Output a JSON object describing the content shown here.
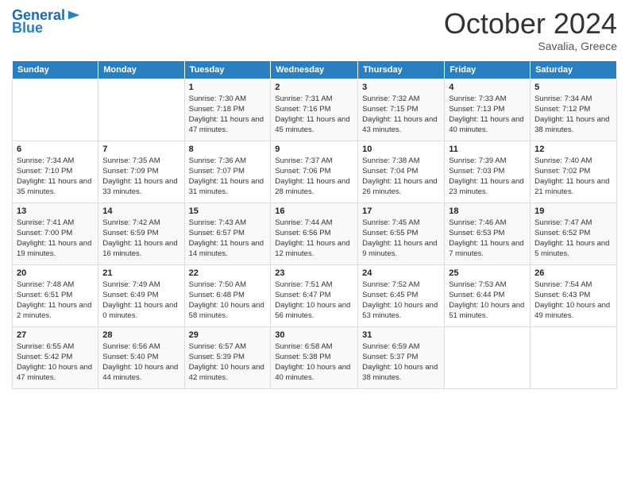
{
  "header": {
    "logo_line1": "General",
    "logo_line2": "Blue",
    "month": "October 2024",
    "location": "Savalia, Greece"
  },
  "days_of_week": [
    "Sunday",
    "Monday",
    "Tuesday",
    "Wednesday",
    "Thursday",
    "Friday",
    "Saturday"
  ],
  "weeks": [
    [
      {
        "day": "",
        "sunrise": "",
        "sunset": "",
        "daylight": ""
      },
      {
        "day": "",
        "sunrise": "",
        "sunset": "",
        "daylight": ""
      },
      {
        "day": "1",
        "sunrise": "Sunrise: 7:30 AM",
        "sunset": "Sunset: 7:18 PM",
        "daylight": "Daylight: 11 hours and 47 minutes."
      },
      {
        "day": "2",
        "sunrise": "Sunrise: 7:31 AM",
        "sunset": "Sunset: 7:16 PM",
        "daylight": "Daylight: 11 hours and 45 minutes."
      },
      {
        "day": "3",
        "sunrise": "Sunrise: 7:32 AM",
        "sunset": "Sunset: 7:15 PM",
        "daylight": "Daylight: 11 hours and 43 minutes."
      },
      {
        "day": "4",
        "sunrise": "Sunrise: 7:33 AM",
        "sunset": "Sunset: 7:13 PM",
        "daylight": "Daylight: 11 hours and 40 minutes."
      },
      {
        "day": "5",
        "sunrise": "Sunrise: 7:34 AM",
        "sunset": "Sunset: 7:12 PM",
        "daylight": "Daylight: 11 hours and 38 minutes."
      }
    ],
    [
      {
        "day": "6",
        "sunrise": "Sunrise: 7:34 AM",
        "sunset": "Sunset: 7:10 PM",
        "daylight": "Daylight: 11 hours and 35 minutes."
      },
      {
        "day": "7",
        "sunrise": "Sunrise: 7:35 AM",
        "sunset": "Sunset: 7:09 PM",
        "daylight": "Daylight: 11 hours and 33 minutes."
      },
      {
        "day": "8",
        "sunrise": "Sunrise: 7:36 AM",
        "sunset": "Sunset: 7:07 PM",
        "daylight": "Daylight: 11 hours and 31 minutes."
      },
      {
        "day": "9",
        "sunrise": "Sunrise: 7:37 AM",
        "sunset": "Sunset: 7:06 PM",
        "daylight": "Daylight: 11 hours and 28 minutes."
      },
      {
        "day": "10",
        "sunrise": "Sunrise: 7:38 AM",
        "sunset": "Sunset: 7:04 PM",
        "daylight": "Daylight: 11 hours and 26 minutes."
      },
      {
        "day": "11",
        "sunrise": "Sunrise: 7:39 AM",
        "sunset": "Sunset: 7:03 PM",
        "daylight": "Daylight: 11 hours and 23 minutes."
      },
      {
        "day": "12",
        "sunrise": "Sunrise: 7:40 AM",
        "sunset": "Sunset: 7:02 PM",
        "daylight": "Daylight: 11 hours and 21 minutes."
      }
    ],
    [
      {
        "day": "13",
        "sunrise": "Sunrise: 7:41 AM",
        "sunset": "Sunset: 7:00 PM",
        "daylight": "Daylight: 11 hours and 19 minutes."
      },
      {
        "day": "14",
        "sunrise": "Sunrise: 7:42 AM",
        "sunset": "Sunset: 6:59 PM",
        "daylight": "Daylight: 11 hours and 16 minutes."
      },
      {
        "day": "15",
        "sunrise": "Sunrise: 7:43 AM",
        "sunset": "Sunset: 6:57 PM",
        "daylight": "Daylight: 11 hours and 14 minutes."
      },
      {
        "day": "16",
        "sunrise": "Sunrise: 7:44 AM",
        "sunset": "Sunset: 6:56 PM",
        "daylight": "Daylight: 11 hours and 12 minutes."
      },
      {
        "day": "17",
        "sunrise": "Sunrise: 7:45 AM",
        "sunset": "Sunset: 6:55 PM",
        "daylight": "Daylight: 11 hours and 9 minutes."
      },
      {
        "day": "18",
        "sunrise": "Sunrise: 7:46 AM",
        "sunset": "Sunset: 6:53 PM",
        "daylight": "Daylight: 11 hours and 7 minutes."
      },
      {
        "day": "19",
        "sunrise": "Sunrise: 7:47 AM",
        "sunset": "Sunset: 6:52 PM",
        "daylight": "Daylight: 11 hours and 5 minutes."
      }
    ],
    [
      {
        "day": "20",
        "sunrise": "Sunrise: 7:48 AM",
        "sunset": "Sunset: 6:51 PM",
        "daylight": "Daylight: 11 hours and 2 minutes."
      },
      {
        "day": "21",
        "sunrise": "Sunrise: 7:49 AM",
        "sunset": "Sunset: 6:49 PM",
        "daylight": "Daylight: 11 hours and 0 minutes."
      },
      {
        "day": "22",
        "sunrise": "Sunrise: 7:50 AM",
        "sunset": "Sunset: 6:48 PM",
        "daylight": "Daylight: 10 hours and 58 minutes."
      },
      {
        "day": "23",
        "sunrise": "Sunrise: 7:51 AM",
        "sunset": "Sunset: 6:47 PM",
        "daylight": "Daylight: 10 hours and 56 minutes."
      },
      {
        "day": "24",
        "sunrise": "Sunrise: 7:52 AM",
        "sunset": "Sunset: 6:45 PM",
        "daylight": "Daylight: 10 hours and 53 minutes."
      },
      {
        "day": "25",
        "sunrise": "Sunrise: 7:53 AM",
        "sunset": "Sunset: 6:44 PM",
        "daylight": "Daylight: 10 hours and 51 minutes."
      },
      {
        "day": "26",
        "sunrise": "Sunrise: 7:54 AM",
        "sunset": "Sunset: 6:43 PM",
        "daylight": "Daylight: 10 hours and 49 minutes."
      }
    ],
    [
      {
        "day": "27",
        "sunrise": "Sunrise: 6:55 AM",
        "sunset": "Sunset: 5:42 PM",
        "daylight": "Daylight: 10 hours and 47 minutes."
      },
      {
        "day": "28",
        "sunrise": "Sunrise: 6:56 AM",
        "sunset": "Sunset: 5:40 PM",
        "daylight": "Daylight: 10 hours and 44 minutes."
      },
      {
        "day": "29",
        "sunrise": "Sunrise: 6:57 AM",
        "sunset": "Sunset: 5:39 PM",
        "daylight": "Daylight: 10 hours and 42 minutes."
      },
      {
        "day": "30",
        "sunrise": "Sunrise: 6:58 AM",
        "sunset": "Sunset: 5:38 PM",
        "daylight": "Daylight: 10 hours and 40 minutes."
      },
      {
        "day": "31",
        "sunrise": "Sunrise: 6:59 AM",
        "sunset": "Sunset: 5:37 PM",
        "daylight": "Daylight: 10 hours and 38 minutes."
      },
      {
        "day": "",
        "sunrise": "",
        "sunset": "",
        "daylight": ""
      },
      {
        "day": "",
        "sunrise": "",
        "sunset": "",
        "daylight": ""
      }
    ]
  ]
}
